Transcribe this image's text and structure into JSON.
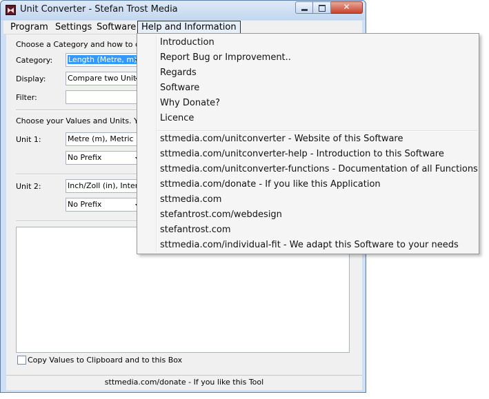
{
  "window": {
    "title": "Unit Converter - Stefan Trost Media"
  },
  "menu": {
    "items": [
      "Program",
      "Settings",
      "Software",
      "Help and Information"
    ]
  },
  "form": {
    "choose_label": "Choose a Category and how to displ",
    "category_label": "Category:",
    "category_value": "Length (Metre, m)",
    "display_label": "Display:",
    "display_value": "Compare two Units",
    "filter_label": "Filter:",
    "filter_value": "",
    "units_label": "Choose your Values and Units. You c",
    "unit1_label": "Unit 1:",
    "unit1_value": "Metre (m), Metric",
    "unit1_prefix": "No Prefix",
    "unit2_label": "Unit 2:",
    "unit2_value": "Inch/Zoll (in), Interna",
    "unit2_prefix": "No Prefix",
    "copy_checkbox_label": "Copy Values to Clipboard and to this Box"
  },
  "status": {
    "text": "sttmedia.com/donate - If you like this Tool"
  },
  "dropdown": {
    "group1": [
      "Introduction",
      "Report Bug or Improvement..",
      "Regards",
      "Software",
      "Why Donate?",
      "Licence"
    ],
    "group2": [
      "sttmedia.com/unitconverter - Website of this Software",
      "sttmedia.com/unitconverter-help - Introduction to this Software",
      "sttmedia.com/unitconverter-functions - Documentation of all Functions",
      "sttmedia.com/donate - If you like this Application",
      "sttmedia.com",
      "stefantrost.com/webdesign",
      "stefantrost.com",
      "sttmedia.com/individual-fit - We adapt this Software to your needs"
    ]
  }
}
